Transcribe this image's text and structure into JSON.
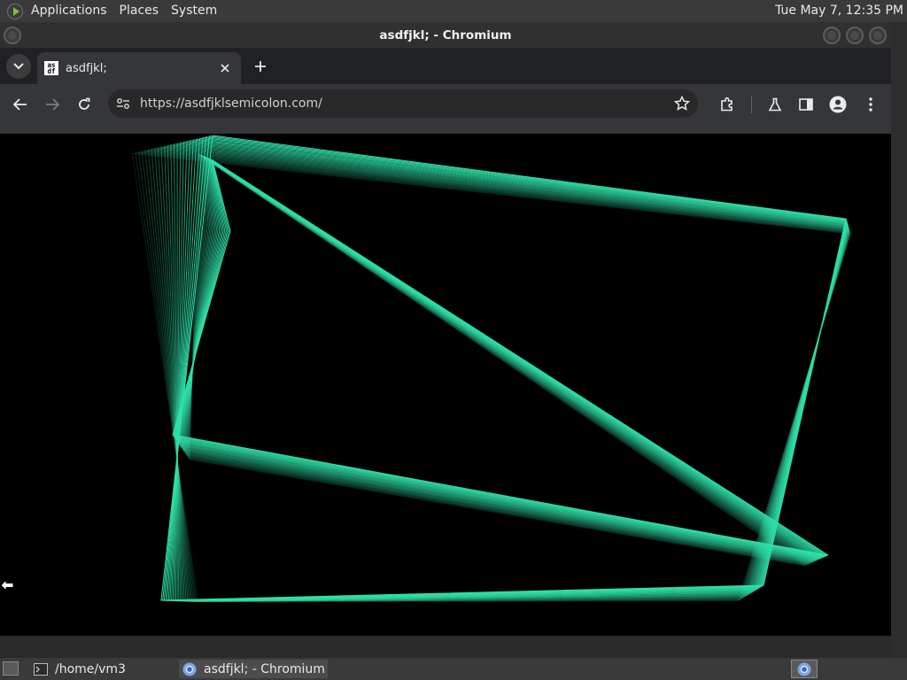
{
  "top_panel": {
    "menus": [
      "Applications",
      "Places",
      "System"
    ],
    "clock": "Tue May 7, 12:35 PM"
  },
  "window": {
    "title": "asdfjkl; - Chromium"
  },
  "tab": {
    "title": "asdfjkl;",
    "favicon_line1": "as",
    "favicon_line2": "df",
    "close_glyph": "✕"
  },
  "new_tab_glyph": "+",
  "tab_list_glyph": "⌄",
  "toolbar": {
    "back_glyph": "←",
    "forward_glyph": "→",
    "reload_glyph": "↻",
    "url": "https://asdfjklsemicolon.com/",
    "bookmark_glyph": "☆",
    "menu_glyph": "⋮"
  },
  "taskbar": {
    "items": [
      {
        "label": "/home/vm3"
      },
      {
        "label": "asdfjkl; - Chromium"
      }
    ]
  },
  "colors": {
    "line_color": "#2fe0a8",
    "background": "#000000"
  }
}
